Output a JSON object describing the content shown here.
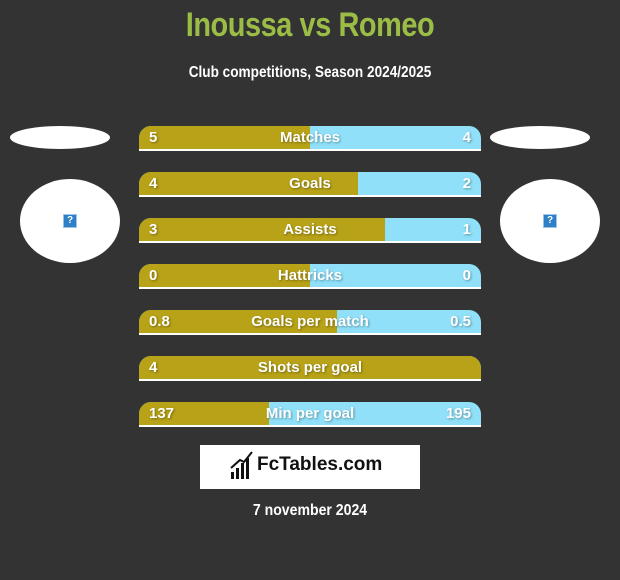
{
  "header": {
    "title": "Inoussa vs Romeo",
    "subtitle": "Club competitions, Season 2024/2025"
  },
  "players": {
    "left": {
      "badge_icon": "unknown-image-icon",
      "badge_glyph": "?"
    },
    "right": {
      "badge_icon": "unknown-image-icon",
      "badge_glyph": "?"
    }
  },
  "colors": {
    "left_bar": "#b8a217",
    "right_bar": "#8fe0f8",
    "title": "#9bbc45",
    "background": "#333333"
  },
  "stats": [
    {
      "label": "Matches",
      "left": "5",
      "right": "4",
      "left_share": 0.5
    },
    {
      "label": "Goals",
      "left": "4",
      "right": "2",
      "left_share": 0.64
    },
    {
      "label": "Assists",
      "left": "3",
      "right": "1",
      "left_share": 0.72
    },
    {
      "label": "Hattricks",
      "left": "0",
      "right": "0",
      "left_share": 0.5
    },
    {
      "label": "Goals per match",
      "left": "0.8",
      "right": "0.5",
      "left_share": 0.58
    },
    {
      "label": "Shots per goal",
      "left": "4",
      "right": "",
      "left_share": 1.0
    },
    {
      "label": "Min per goal",
      "left": "137",
      "right": "195",
      "left_share": 0.38
    }
  ],
  "footer": {
    "logo_text": "FcTables.com",
    "date": "7 november 2024"
  }
}
